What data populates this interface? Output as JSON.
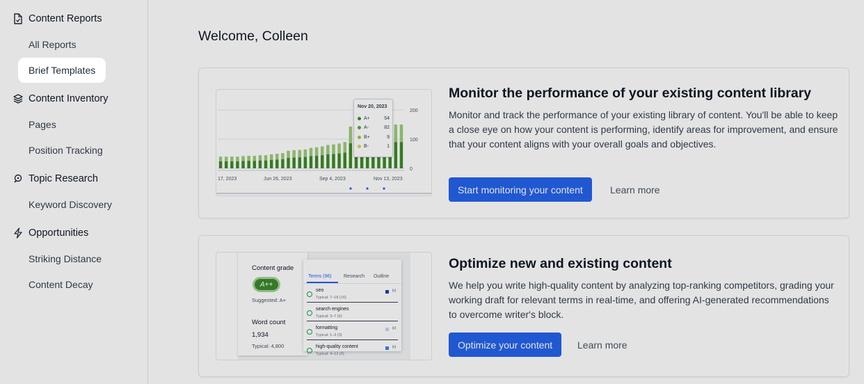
{
  "sidebar": {
    "groups": [
      {
        "title": "Content Reports",
        "icon": "document-check-icon",
        "items": [
          "All Reports",
          "Brief Templates"
        ]
      },
      {
        "title": "Content Inventory",
        "icon": "layers-stack-icon",
        "items": [
          "Pages",
          "Position Tracking"
        ]
      },
      {
        "title": "Topic Research",
        "icon": "topic-research-icon",
        "items": [
          "Keyword Discovery"
        ]
      },
      {
        "title": "Opportunities",
        "icon": "lightning-bolt-icon",
        "items": [
          "Striking Distance",
          "Content Decay"
        ]
      }
    ],
    "active_item": "Brief Templates"
  },
  "main": {
    "welcome": "Welcome, Colleen",
    "cards": [
      {
        "title": "Monitor the performance of your existing content library",
        "description": "Monitor and track the performance of your existing library of content. You'll be able to keep a close eye on how your content is performing, identify areas for improvement, and ensure that your content aligns with your overall goals and objectives.",
        "button": "Start monitoring your content",
        "link": "Learn more"
      },
      {
        "title": "Optimize new and existing content",
        "description": "We help you write high-quality content by analyzing top-ranking competitors, grading your working draft for relevant terms in real-time, and offering AI-generated recommendations to overcome writer's block.",
        "button": "Optimize your content",
        "link": "Learn more"
      }
    ]
  },
  "illustration_chart": {
    "x_ticks": [
      "17, 2023",
      "Jun 26, 2023",
      "Sep 4, 2023",
      "Nov 13, 2023"
    ],
    "y_ticks": [
      "200",
      "100",
      "0"
    ],
    "tooltip": {
      "date": "Nov 20, 2023",
      "rows": [
        {
          "label": "A+",
          "value": "54",
          "color": "#3f8f2a"
        },
        {
          "label": "A-",
          "value": "82",
          "color": "#5aaa3c"
        },
        {
          "label": "B+",
          "value": "9",
          "color": "#9bc93e"
        },
        {
          "label": "B-",
          "value": "1",
          "color": "#c9d94a"
        }
      ]
    },
    "bar_values": [
      40,
      40,
      40,
      40,
      42,
      43,
      43,
      45,
      45,
      48,
      50,
      52,
      60,
      62,
      63,
      65,
      70,
      72,
      75,
      80,
      82,
      85,
      90,
      143,
      148,
      150,
      148,
      152,
      153,
      155,
      148,
      150,
      150
    ],
    "colors": {
      "bar_dark": "#3d8a26",
      "bar_light": "#9ccc7a"
    }
  },
  "illustration_grade": {
    "content_grade_label": "Content grade",
    "grade": "A++",
    "suggested": "Suggested: A+",
    "word_count_label": "Word count",
    "word_count": "1,934",
    "typical": "Typical: 4,800",
    "tabs": [
      "Terms (96)",
      "Research",
      "Outline"
    ],
    "terms": [
      {
        "name": "seo",
        "typical": "Typical: 7–18 (16)",
        "color": "#1e40af"
      },
      {
        "name": "search engines",
        "typical": "Typical: 3–7 (6)",
        "color": ""
      },
      {
        "name": "formatting",
        "typical": "Typical: 1–3 (3)",
        "color": "#c7d2fe"
      },
      {
        "name": "high-quality content",
        "typical": "Typical: 4–12 (4)",
        "color": "#3b82f6"
      }
    ],
    "heading_tag": "H"
  }
}
